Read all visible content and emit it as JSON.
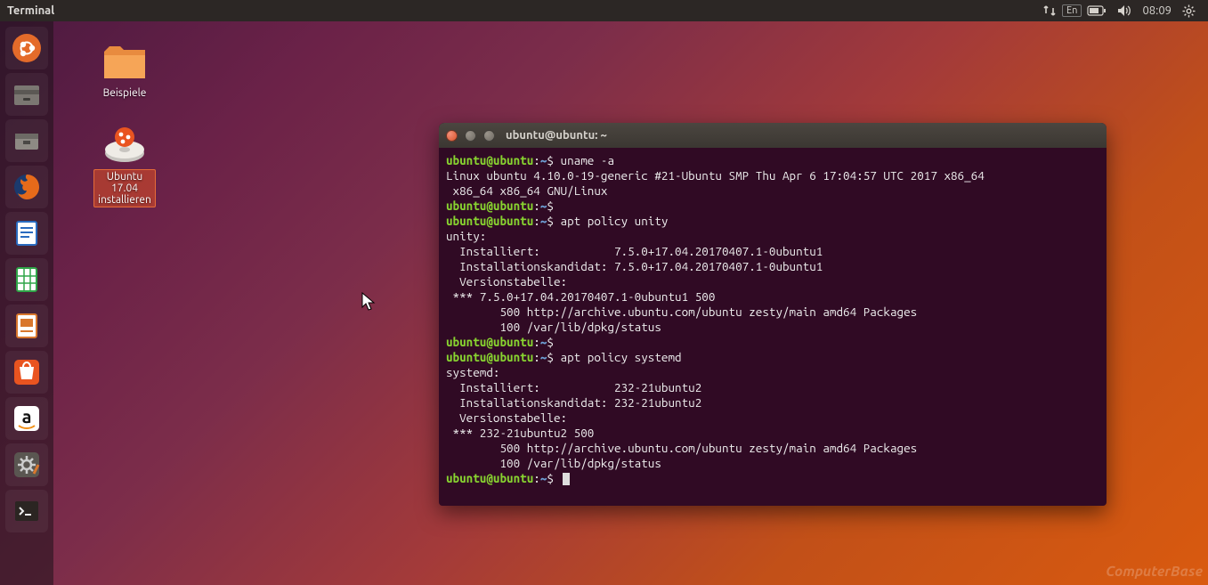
{
  "top_panel": {
    "app_title": "Terminal",
    "lang": "En",
    "clock": "08:09"
  },
  "launcher": {
    "items": [
      {
        "name": "dash",
        "title": "Dash"
      },
      {
        "name": "files",
        "title": "Files"
      },
      {
        "name": "archive",
        "title": "Archive Manager"
      },
      {
        "name": "firefox",
        "title": "Firefox"
      },
      {
        "name": "writer",
        "title": "LibreOffice Writer"
      },
      {
        "name": "calc",
        "title": "LibreOffice Calc"
      },
      {
        "name": "impress",
        "title": "LibreOffice Impress"
      },
      {
        "name": "software",
        "title": "Ubuntu Software"
      },
      {
        "name": "amazon",
        "title": "Amazon"
      },
      {
        "name": "settings",
        "title": "System Settings"
      },
      {
        "name": "terminal",
        "title": "Terminal"
      }
    ]
  },
  "desktop": {
    "icon1": {
      "label": "Beispiele"
    },
    "icon2": {
      "label": "Ubuntu\n17.04\ninstallieren"
    }
  },
  "terminal": {
    "title": "ubuntu@ubuntu: ~",
    "prompt": {
      "user": "ubuntu@ubuntu",
      "sep": ":",
      "path": "~",
      "suffix": "$"
    },
    "lines": [
      {
        "type": "prompt",
        "cmd": "uname -a"
      },
      {
        "type": "out",
        "text": "Linux ubuntu 4.10.0-19-generic #21-Ubuntu SMP Thu Apr 6 17:04:57 UTC 2017 x86_64"
      },
      {
        "type": "out",
        "text": " x86_64 x86_64 GNU/Linux"
      },
      {
        "type": "prompt",
        "cmd": ""
      },
      {
        "type": "prompt",
        "cmd": "apt policy unity"
      },
      {
        "type": "out",
        "text": "unity:"
      },
      {
        "type": "out",
        "text": "  Installiert:           7.5.0+17.04.20170407.1-0ubuntu1"
      },
      {
        "type": "out",
        "text": "  Installationskandidat: 7.5.0+17.04.20170407.1-0ubuntu1"
      },
      {
        "type": "out",
        "text": "  Versionstabelle:"
      },
      {
        "type": "out",
        "text": " *** 7.5.0+17.04.20170407.1-0ubuntu1 500"
      },
      {
        "type": "out",
        "text": "        500 http://archive.ubuntu.com/ubuntu zesty/main amd64 Packages"
      },
      {
        "type": "out",
        "text": "        100 /var/lib/dpkg/status"
      },
      {
        "type": "prompt",
        "cmd": ""
      },
      {
        "type": "prompt",
        "cmd": "apt policy systemd"
      },
      {
        "type": "out",
        "text": "systemd:"
      },
      {
        "type": "out",
        "text": "  Installiert:           232-21ubuntu2"
      },
      {
        "type": "out",
        "text": "  Installationskandidat: 232-21ubuntu2"
      },
      {
        "type": "out",
        "text": "  Versionstabelle:"
      },
      {
        "type": "out",
        "text": " *** 232-21ubuntu2 500"
      },
      {
        "type": "out",
        "text": "        500 http://archive.ubuntu.com/ubuntu zesty/main amd64 Packages"
      },
      {
        "type": "out",
        "text": "        100 /var/lib/dpkg/status"
      },
      {
        "type": "prompt",
        "cmd": "",
        "cursor": true
      }
    ]
  },
  "watermark": "ComputerBase"
}
